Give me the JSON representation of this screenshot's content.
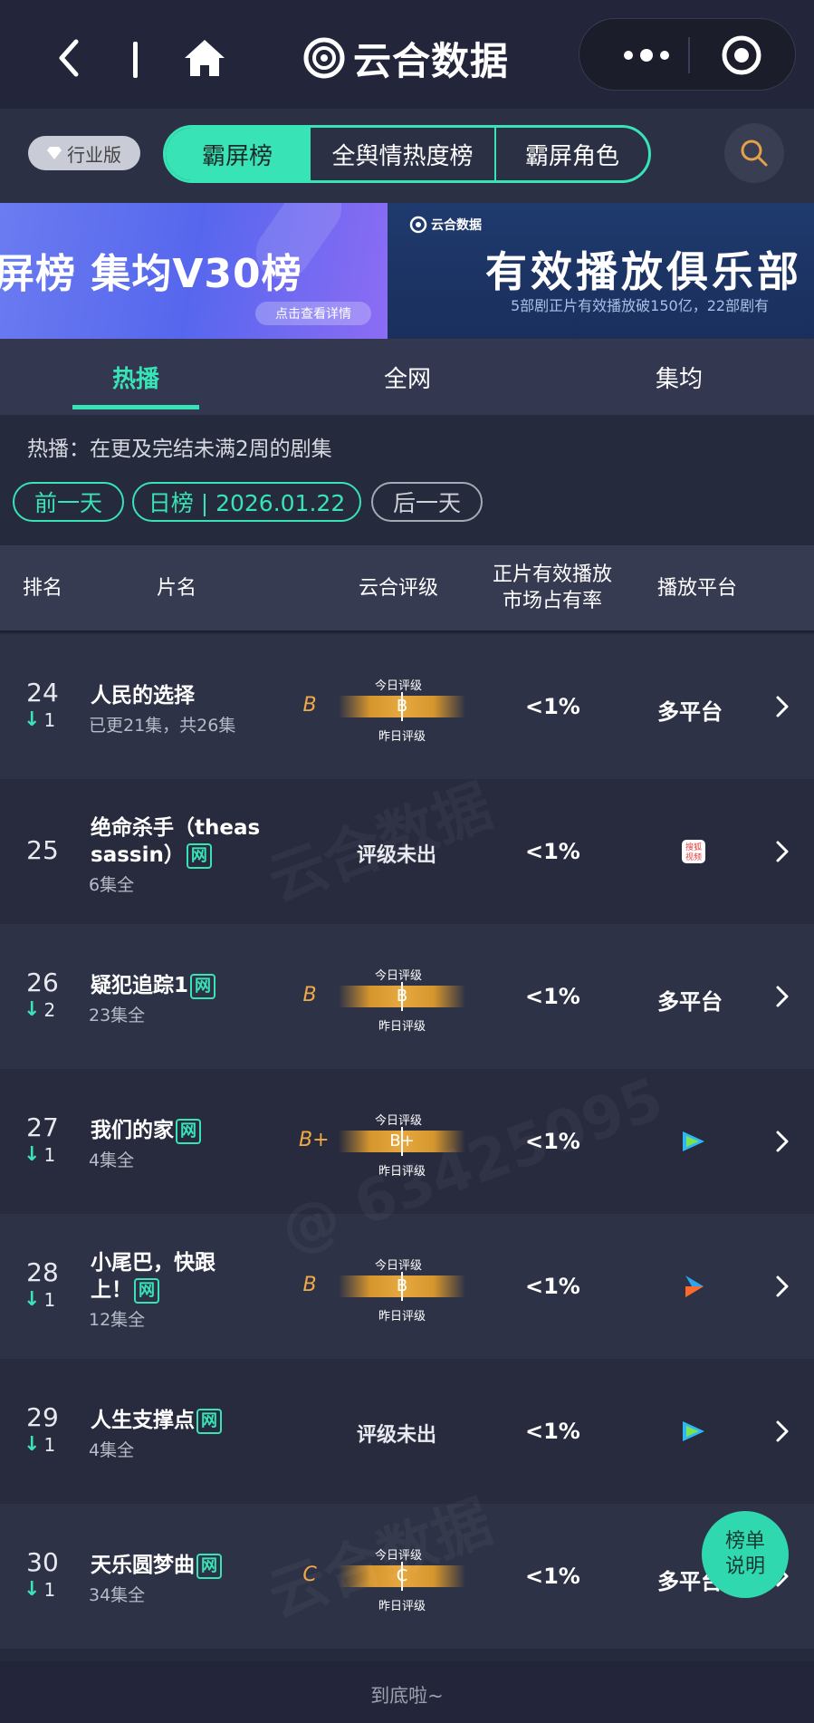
{
  "topbar": {
    "title": "云合数据"
  },
  "segment": {
    "industry_label": "行业版",
    "tabs": [
      {
        "label": "霸屏榜",
        "active": true
      },
      {
        "label": "全舆情热度榜",
        "active": false
      },
      {
        "label": "霸屏角色",
        "active": false
      }
    ]
  },
  "banners": {
    "left": {
      "text": "屏榜 集均V30榜",
      "button": "点击查看详情"
    },
    "right": {
      "logo": "云合数据",
      "title": "有效播放俱乐部",
      "subtitle": "5部剧正片有效播放破150亿，22部剧有"
    }
  },
  "subtabs": [
    {
      "label": "热播",
      "active": true
    },
    {
      "label": "全网",
      "active": false
    },
    {
      "label": "集均",
      "active": false
    }
  ],
  "description": "热播：在更及完结未满2周的剧集",
  "date_nav": {
    "prev": "前一天",
    "current": "日榜 | 2026.01.22",
    "next": "后一天"
  },
  "table_header": {
    "rank": "排名",
    "name": "片名",
    "rating": "云合评级",
    "share_line1": "正片有效播放",
    "share_line2": "市场占有率",
    "platform": "播放平台"
  },
  "labels": {
    "today_rating": "今日评级",
    "yesterday_rating": "昨日评级",
    "net_badge": "网"
  },
  "rows": [
    {
      "rank": "24",
      "delta": "1",
      "title1": "人民的选择",
      "title2": "",
      "badge": false,
      "episodes": "已更21集，共26集",
      "grade": "B",
      "gauge": "B",
      "rated": true,
      "share": "<1%",
      "platform": "多平台",
      "icon": ""
    },
    {
      "rank": "25",
      "delta": "",
      "title1": "绝命杀手（theas",
      "title2": "sassin）",
      "badge": true,
      "episodes": "6集全",
      "grade": "",
      "gauge": "",
      "rated": false,
      "unrated_text": "评级未出",
      "share": "<1%",
      "platform": "",
      "icon": "sohu-video-icon"
    },
    {
      "rank": "26",
      "delta": "2",
      "title1": "疑犯追踪1",
      "title2": "",
      "badge": true,
      "episodes": "23集全",
      "grade": "B",
      "gauge": "B",
      "rated": true,
      "share": "<1%",
      "platform": "多平台",
      "icon": ""
    },
    {
      "rank": "27",
      "delta": "1",
      "title1": "我们的家",
      "title2": "",
      "badge": true,
      "episodes": "4集全",
      "grade": "B+",
      "gauge": "B+",
      "rated": true,
      "share": "<1%",
      "platform": "",
      "icon": "tencent-video-icon"
    },
    {
      "rank": "28",
      "delta": "1",
      "title1": "小尾巴，快跟",
      "title2": "上！",
      "badge": true,
      "episodes": "12集全",
      "grade": "B",
      "gauge": "B",
      "rated": true,
      "share": "<1%",
      "platform": "",
      "icon": "youku-icon"
    },
    {
      "rank": "29",
      "delta": "1",
      "title1": "人生支撑点",
      "title2": "",
      "badge": true,
      "episodes": "4集全",
      "grade": "",
      "gauge": "",
      "rated": false,
      "unrated_text": "评级未出",
      "share": "<1%",
      "platform": "",
      "icon": "tencent-video-icon"
    },
    {
      "rank": "30",
      "delta": "1",
      "title1": "天乐圆梦曲",
      "title2": "",
      "badge": true,
      "episodes": "34集全",
      "grade": "C",
      "gauge": "C",
      "rated": true,
      "share": "<1%",
      "platform": "多平台",
      "icon": ""
    }
  ],
  "float_button": {
    "line1": "榜单",
    "line2": "说明"
  },
  "footer": "到底啦~",
  "colors": {
    "accent": "#38e3b6",
    "grade": "#f0a944",
    "background": "#262a3d"
  }
}
